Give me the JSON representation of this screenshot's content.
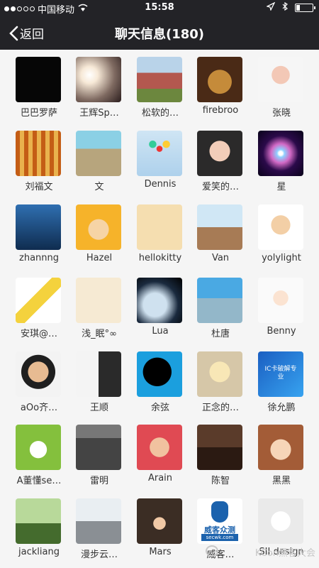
{
  "status_bar": {
    "carrier": "中国移动",
    "time": "15:58",
    "signal_dots": [
      true,
      true,
      false,
      false,
      false
    ]
  },
  "nav": {
    "back_label": "返回",
    "title": "聊天信息(180)"
  },
  "members": [
    {
      "name": "巴巴罗萨",
      "avatar": "a-dark"
    },
    {
      "name": "王辉Sp…",
      "avatar": "a-glow"
    },
    {
      "name": "松软的…",
      "avatar": "a-house"
    },
    {
      "name": "firebroo",
      "avatar": "a-dog"
    },
    {
      "name": "张晓",
      "avatar": "a-baby"
    },
    {
      "name": "刘福文",
      "avatar": "a-forest"
    },
    {
      "name": "文",
      "avatar": "a-girl-lake"
    },
    {
      "name": "Dennis",
      "avatar": "a-balloons"
    },
    {
      "name": "爱笑的…",
      "avatar": "a-smile"
    },
    {
      "name": "星",
      "avatar": "a-nebula"
    },
    {
      "name": "zhannng",
      "avatar": "a-code"
    },
    {
      "name": "Hazel",
      "avatar": "a-cartoon"
    },
    {
      "name": "hellokitty",
      "avatar": "a-bottles"
    },
    {
      "name": "Van",
      "avatar": "a-street"
    },
    {
      "name": "yolylight",
      "avatar": "a-wxface"
    },
    {
      "name": "安琪@…",
      "avatar": "a-cup"
    },
    {
      "name": "浅_眠°∞",
      "avatar": "a-sketch"
    },
    {
      "name": "Lua",
      "avatar": "a-planet"
    },
    {
      "name": "杜唐",
      "avatar": "a-water"
    },
    {
      "name": "Benny",
      "avatar": "a-chibi"
    },
    {
      "name": "aOo齐…",
      "avatar": "a-boy"
    },
    {
      "name": "王顺",
      "avatar": "a-wed"
    },
    {
      "name": "余弦",
      "avatar": "a-blackeye"
    },
    {
      "name": "正念的…",
      "avatar": "a-anime"
    },
    {
      "name": "徐允鹏",
      "avatar": "a-tag"
    },
    {
      "name": "A董懂se…",
      "avatar": "a-glasses"
    },
    {
      "name": "雷明",
      "avatar": "a-bw"
    },
    {
      "name": "Arain",
      "avatar": "a-kid"
    },
    {
      "name": "陈智",
      "avatar": "a-room"
    },
    {
      "name": "黑黑",
      "avatar": "a-kwai"
    },
    {
      "name": "jackliang",
      "avatar": "a-guy"
    },
    {
      "name": "漫步云…",
      "avatar": "a-jet"
    },
    {
      "name": "Mars",
      "avatar": "a-ultra"
    },
    {
      "name": "威客…",
      "avatar": "a-logo"
    },
    {
      "name": "SII.design",
      "avatar": "a-sheep"
    }
  ],
  "special": {
    "logo_main": "威客众测",
    "logo_url": "secwk.com",
    "tag_text": "IC卡破解专业"
  },
  "watermark": "KCon黑客大会"
}
